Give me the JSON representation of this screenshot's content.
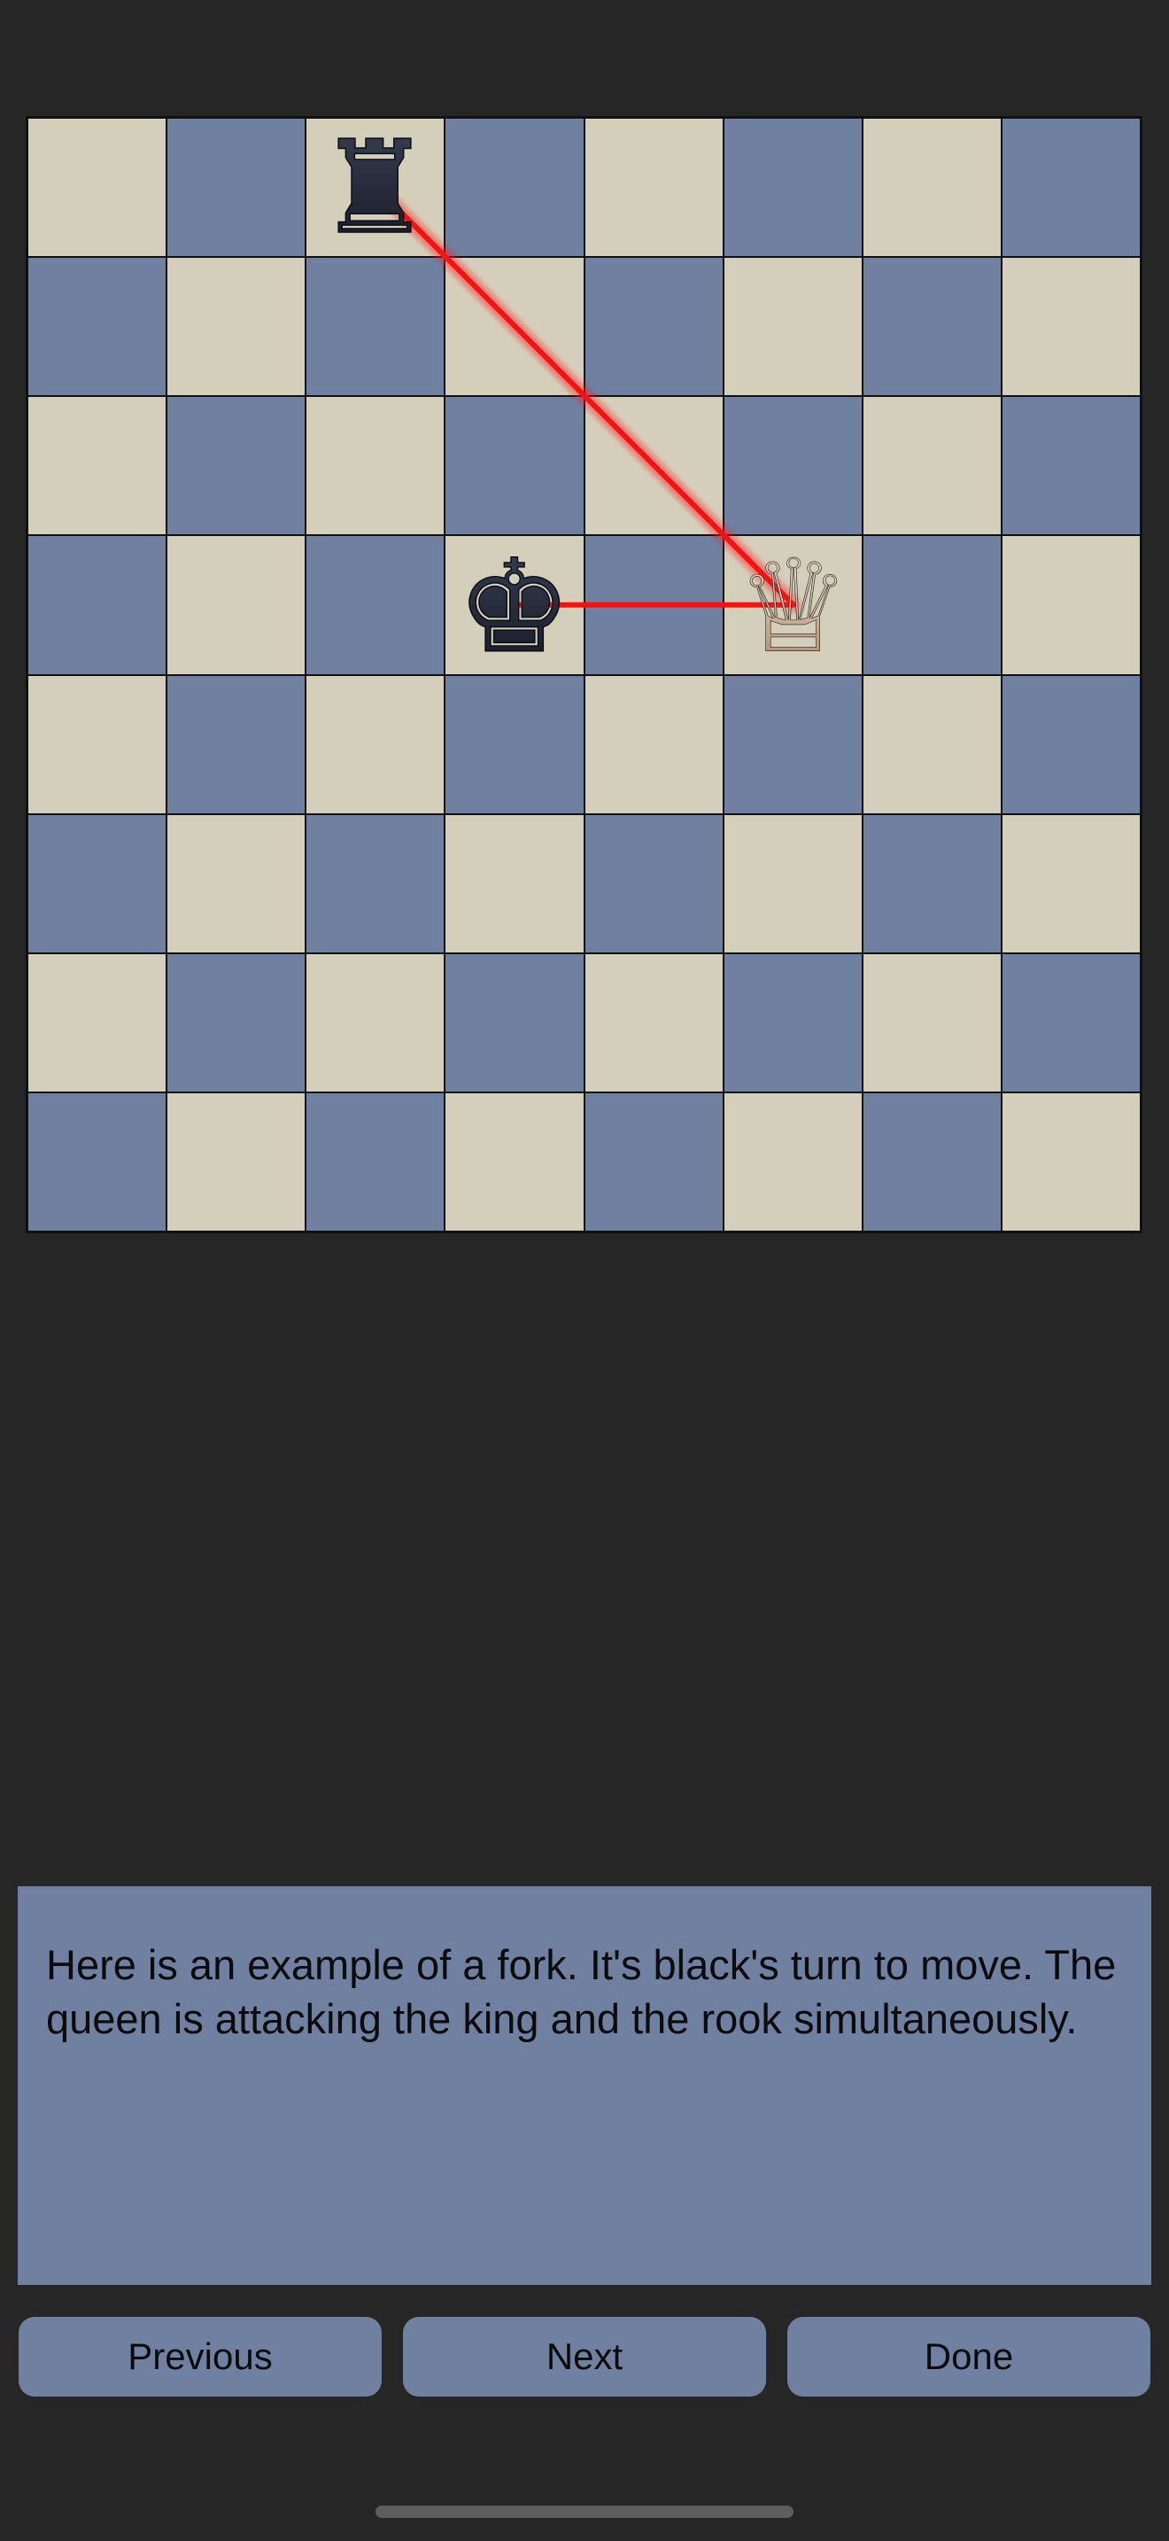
{
  "colors": {
    "background": "#262626",
    "light_square": "#d4cfbb",
    "dark_square": "#6f80a0",
    "panel": "#6f80a0",
    "button": "#6f80a0",
    "attack_line": "#ff1010",
    "black_piece": "#1f2330",
    "white_piece": "#c9a98a"
  },
  "board": {
    "files": 8,
    "ranks": 8,
    "top_left_is_light": true,
    "pieces": [
      {
        "name": "black-rook",
        "color": "black",
        "type": "rook",
        "glyph": "♜",
        "col": 2,
        "row": 0
      },
      {
        "name": "black-king",
        "color": "black",
        "type": "king",
        "glyph": "♚",
        "col": 3,
        "row": 3
      },
      {
        "name": "white-queen",
        "color": "white",
        "type": "queen",
        "glyph": "♕",
        "col": 5,
        "row": 3
      }
    ],
    "attack_lines": [
      {
        "from": [
          5,
          3
        ],
        "to": [
          2,
          0
        ]
      },
      {
        "from": [
          5,
          3
        ],
        "to": [
          3,
          3
        ]
      }
    ]
  },
  "info": {
    "text": "Here is an example of a fork. It's black's turn to move. The queen is attacking the king and the rook simultaneously."
  },
  "buttons": {
    "previous": "Previous",
    "next": "Next",
    "done": "Done"
  }
}
